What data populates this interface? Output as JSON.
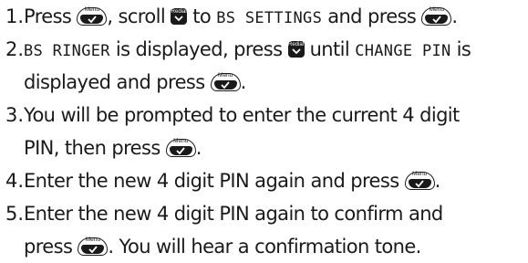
{
  "icons": {
    "menu_button": {
      "label": "Menu",
      "icon": "menu-check-icon"
    },
    "redial_button": {
      "label": "Redial",
      "icon": "redial-chevron-icon"
    }
  },
  "steps": [
    {
      "number": "1.",
      "t1": "Press",
      "t2": ", scroll",
      "display1": "BS SETTINGS",
      "t3": "to",
      "t4": "and press",
      "t5": "."
    },
    {
      "number": "2.",
      "display1": "BS RINGER",
      "t1": "is displayed, press",
      "t2": "until",
      "display2": "CHANGE PIN",
      "t3": "is",
      "t4": "displayed and press",
      "t5": "."
    },
    {
      "number": "3.",
      "t1": "You will be prompted to enter the current 4 digit",
      "t2": "PIN, then press",
      "t3": "."
    },
    {
      "number": "4.",
      "t1": "Enter the new 4 digit PIN again and press",
      "t2": "."
    },
    {
      "number": "5.",
      "t1": "Enter the new 4 digit PIN again to confirm and",
      "t2": "press",
      "t3": ". You will hear a confirmation tone."
    }
  ]
}
